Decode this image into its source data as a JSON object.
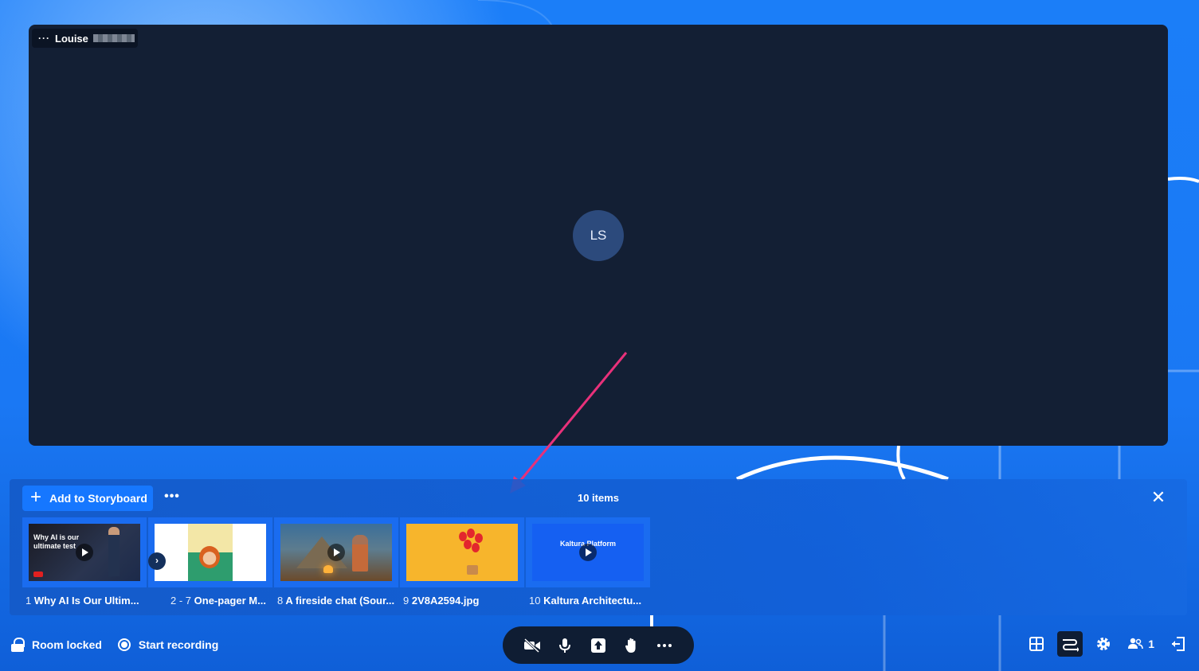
{
  "stage": {
    "participant_name": "Louise",
    "avatar_initials": "LS"
  },
  "storyboard": {
    "add_label": "Add to Storyboard",
    "more_label": "•••",
    "count_label": "10 items",
    "close_label": "✕",
    "items": [
      {
        "num": "1",
        "title": "Why AI Is Our Ultim...",
        "thumb_text": "Why AI is our ultimate test"
      },
      {
        "num": "2 - 7",
        "title": "One-pager M...",
        "thumb_text": ""
      },
      {
        "num": "8",
        "title": "A fireside chat (Sour...",
        "thumb_text": ""
      },
      {
        "num": "9",
        "title": "2V8A2594.jpg",
        "thumb_text": ""
      },
      {
        "num": "10",
        "title": "Kaltura Architectu...",
        "thumb_text": "Kaltura Platform"
      }
    ],
    "group_chevron": "›"
  },
  "bottom_bar": {
    "room_locked": "Room locked",
    "start_recording": "Start recording",
    "participants_count": "1"
  },
  "colors": {
    "background": "#1a7cf7",
    "stage": "#131f34",
    "avatar": "#2c4a7c",
    "control_pill": "#0f1d33",
    "arrow": "#e8317a"
  }
}
